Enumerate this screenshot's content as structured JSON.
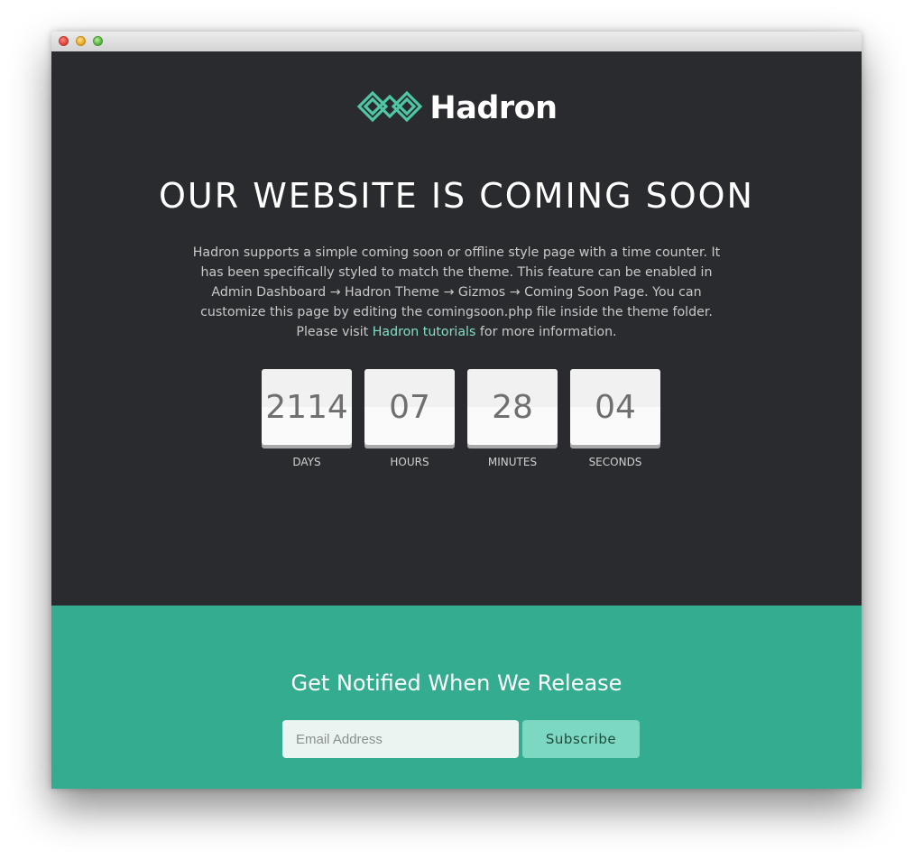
{
  "brand": {
    "name": "Hadron",
    "logo_icon": "infinity-diamond-logo",
    "accent_color": "#4fc7a6"
  },
  "hero": {
    "headline": "OUR WEBSITE IS COMING SOON",
    "description_before_link": "Hadron supports a simple coming soon or offline style page with a time counter. It has been specifically styled to match the theme. This feature can be enabled in Admin Dashboard → Hadron Theme → Gizmos → Coming Soon Page. You can customize this page by editing the comingsoon.php file inside the theme folder. Please visit ",
    "link_text": "Hadron tutorials",
    "description_after_link": " for more information.",
    "background_color": "#2a2b2e"
  },
  "countdown": [
    {
      "value": "2114",
      "label": "DAYS"
    },
    {
      "value": "07",
      "label": "HOURS"
    },
    {
      "value": "28",
      "label": "MINUTES"
    },
    {
      "value": "04",
      "label": "SECONDS"
    }
  ],
  "notify": {
    "title": "Get Notified When We Release",
    "email_placeholder": "Email Address",
    "email_value": "",
    "subscribe_label": "Subscribe",
    "background_color": "#33ac8f"
  },
  "window": {
    "controls": [
      "close",
      "minimize",
      "maximize"
    ]
  }
}
